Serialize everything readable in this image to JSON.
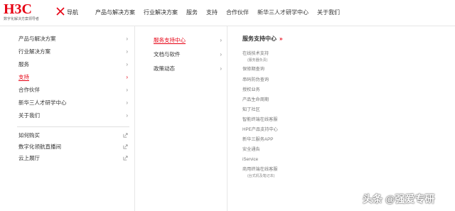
{
  "header": {
    "logo_text": "H3C",
    "logo_subtitle": "数字化解决方案领导者",
    "nav_toggle_label": "导航",
    "top_nav": [
      "产品与解决方案",
      "行业解决方案",
      "服务",
      "支持",
      "合作伙伴",
      "新华三人才研学中心",
      "关于我们"
    ],
    "accent_color": "#e60012"
  },
  "col1": {
    "items": [
      {
        "label": "产品与解决方案",
        "active": false
      },
      {
        "label": "行业解决方案",
        "active": false
      },
      {
        "label": "服务",
        "active": false
      },
      {
        "label": "支持",
        "active": true
      },
      {
        "label": "合作伙伴",
        "active": false
      },
      {
        "label": "新华三人才研学中心",
        "active": false
      },
      {
        "label": "关于我们",
        "active": false
      }
    ],
    "external_links": [
      "如何购买",
      "数字化领航直播间",
      "云上展厅"
    ]
  },
  "col2": {
    "items": [
      {
        "label": "服务支持中心",
        "active": true
      },
      {
        "label": "文档与软件",
        "active": false
      },
      {
        "label": "政策动态",
        "active": false
      }
    ]
  },
  "col3": {
    "title": "服务支持中心",
    "title_arrows": "»",
    "items": [
      {
        "label": "在线技术支持",
        "sub": "(服务器负责)"
      },
      {
        "label": "保修期查询"
      },
      {
        "label": "串码防伪查询"
      },
      {
        "label": "授权业务"
      },
      {
        "label": "产品生命周期"
      },
      {
        "label": "知了社区"
      },
      {
        "label": "智能终端在线客服"
      },
      {
        "label": "HPE产品支持中心"
      },
      {
        "label": "新华三服务APP"
      },
      {
        "label": "安全通告"
      },
      {
        "label": "iService"
      },
      {
        "label": "商用终端在线客服",
        "sub": "(台式机及笔记本)"
      }
    ]
  },
  "watermark": "头条 @强爱专研"
}
